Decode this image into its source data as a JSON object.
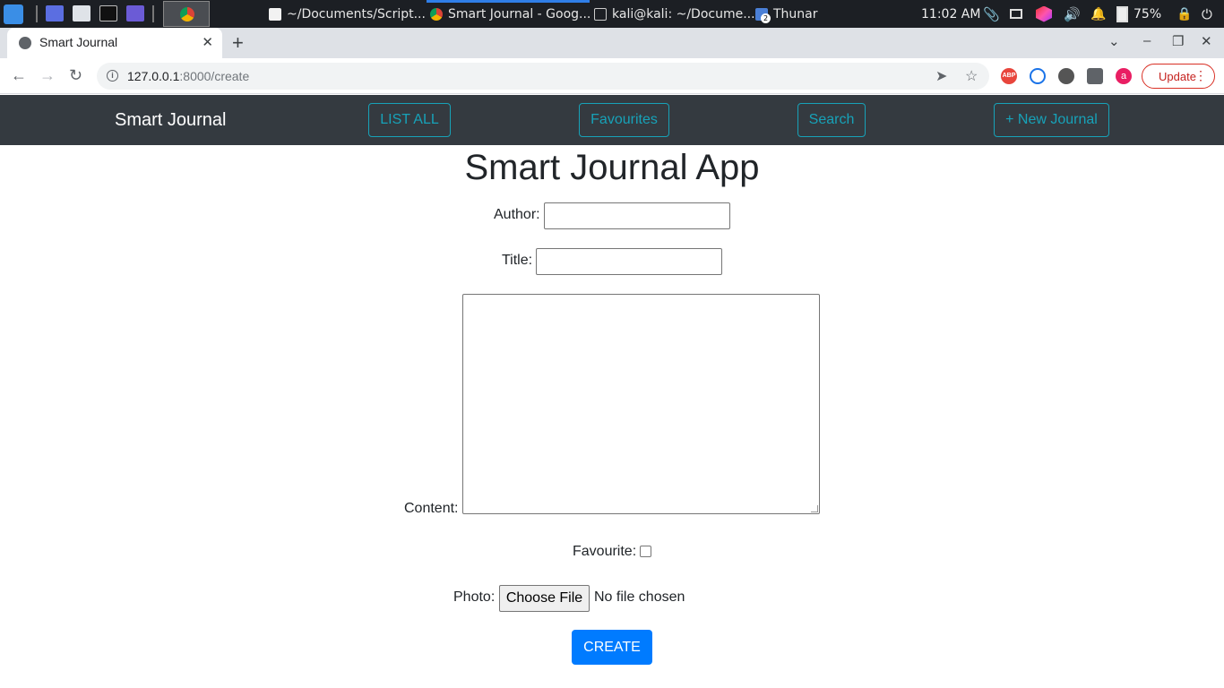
{
  "taskbar": {
    "tasks": [
      "~/Documents/Script...",
      "Smart Journal - Goog...",
      "kali@kali: ~/Docume...",
      "Thunar"
    ],
    "thunar_badge": "2",
    "clock": "11:02 AM",
    "battery": "75%"
  },
  "browser": {
    "tab_title": "Smart Journal",
    "tab_close": "✕",
    "new_tab": "+",
    "url_host": "127.0.0.1",
    "url_path": ":8000/create",
    "update_label": "Update",
    "profile_letter": "a",
    "abp_label": "ABP"
  },
  "navbar": {
    "brand": "Smart Journal",
    "list_all": "LIST ALL",
    "favourites": "Favourites",
    "search": "Search",
    "new_journal": "+ New Journal",
    "accent": "#17a2b8"
  },
  "form": {
    "heading": "Smart Journal App",
    "author_label": "Author:",
    "author_value": "",
    "title_label": "Title:",
    "title_value": "",
    "content_label": "Content:",
    "content_value": "",
    "favourite_label": "Favourite:",
    "favourite_checked": false,
    "photo_label": "Photo:",
    "choose_file": "Choose File",
    "no_file": "No file chosen",
    "create_label": "CREATE",
    "primary_color": "#007bff"
  }
}
